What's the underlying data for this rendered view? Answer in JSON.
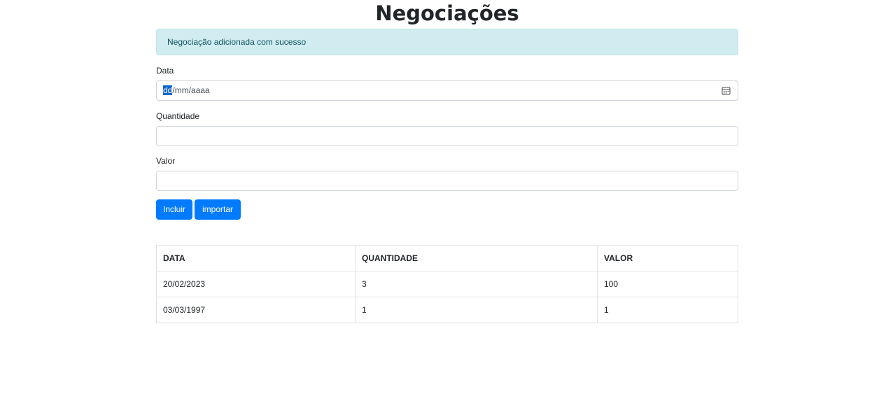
{
  "page": {
    "title": "Negociações"
  },
  "alert": {
    "message": "Negociação adicionada com sucesso"
  },
  "form": {
    "data_label": "Data",
    "data_placeholder_selected": "dd",
    "data_placeholder_rest": "/mm/aaaa",
    "data_icon": "calendar-icon",
    "quantidade_label": "Quantidade",
    "quantidade_value": "",
    "valor_label": "Valor",
    "valor_value": "",
    "incluir_label": "Incluir",
    "importar_label": "importar"
  },
  "table": {
    "headers": [
      "DATA",
      "QUANTIDADE",
      "VALOR"
    ],
    "rows": [
      [
        "20/02/2023",
        "3",
        "100"
      ],
      [
        "03/03/1997",
        "1",
        "1"
      ]
    ]
  },
  "colors": {
    "primary": "#007bff",
    "alert_bg": "#d1ecf1",
    "alert_text": "#0c5460"
  }
}
